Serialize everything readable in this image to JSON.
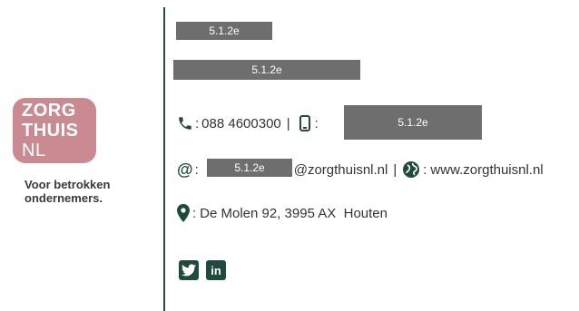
{
  "logo": {
    "line1": "ZORG",
    "line2": "THUIS",
    "line3": "NL",
    "tagline": "Voor betrokken ondernemers."
  },
  "redactions": {
    "name": "5.1.2e",
    "title": "5.1.2e",
    "mobile": "5.1.2e",
    "email_user": "5.1.2e"
  },
  "contact": {
    "phone_sep": ":",
    "phone": "088 4600300",
    "pipe1": "|",
    "mobile_sep": ":",
    "email_prefix": ":",
    "email_domain": "@zorgthuisnl.nl",
    "pipe2": "|",
    "web_sep": ":",
    "website": "www.zorgthuisnl.nl",
    "address_sep": ":",
    "address": "De Molen 92, 3995 AX  Houten"
  },
  "social": {
    "twitter": "twitter-icon",
    "linkedin_label": "in"
  },
  "colors": {
    "brand_green": "#1f4a3d",
    "logo_pink": "#c98a92",
    "redaction": "#6e6e6e"
  }
}
